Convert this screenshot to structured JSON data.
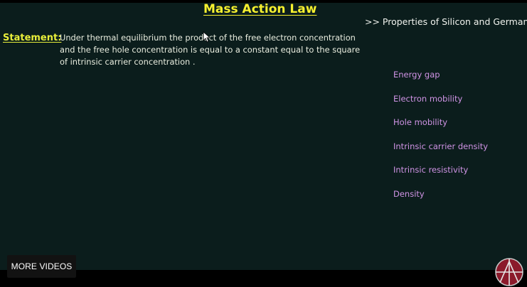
{
  "lesson": {
    "title": "Mass Action Law",
    "statement_label": "Statement:",
    "statement_lines": [
      "Under thermal equilibrium the product of the free electron concentration",
      "and the free hole concentration is equal to a constant equal to the square",
      "of intrinsic carrier concentration ."
    ]
  },
  "properties": {
    "heading": ">> Properties of Silicon and Germaniu",
    "items": [
      "Energy gap",
      "Electron mobility",
      "Hole mobility",
      "Intrinsic carrier density",
      "Intrinsic resistivity",
      "Density"
    ]
  },
  "player": {
    "more_videos_label": "MORE VIDEOS"
  },
  "colors": {
    "board_background": "#0b1d1c",
    "title_yellow": "#f6f02f",
    "property_purple": "#cf93e4",
    "logo_red": "#8b1a2b"
  },
  "icons": {
    "cursor": "mouse-pointer-icon",
    "logo": "channel-logo-icon"
  }
}
